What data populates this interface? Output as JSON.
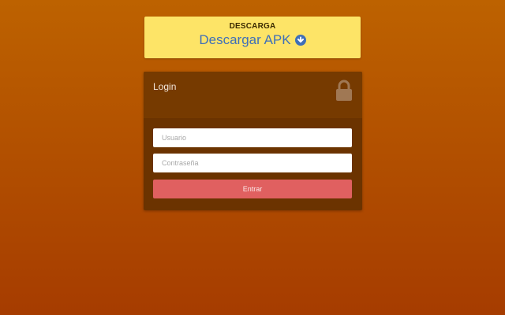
{
  "download": {
    "heading": "DESCARGA",
    "link_label": "Descargar APK",
    "icon": "arrow-down-circle-icon",
    "link_color": "#3f6fb8",
    "background_color": "#fde467"
  },
  "login": {
    "title": "Login",
    "icon": "lock-icon",
    "username": {
      "placeholder": "Usuario",
      "value": ""
    },
    "password": {
      "placeholder": "Contraseña",
      "value": ""
    },
    "submit_label": "Entrar",
    "colors": {
      "panel": "#6b3300",
      "header": "#763a00",
      "button": "#e06060"
    }
  },
  "colors": {
    "background_top": "#bd6200",
    "background_bottom": "#a63c00"
  }
}
